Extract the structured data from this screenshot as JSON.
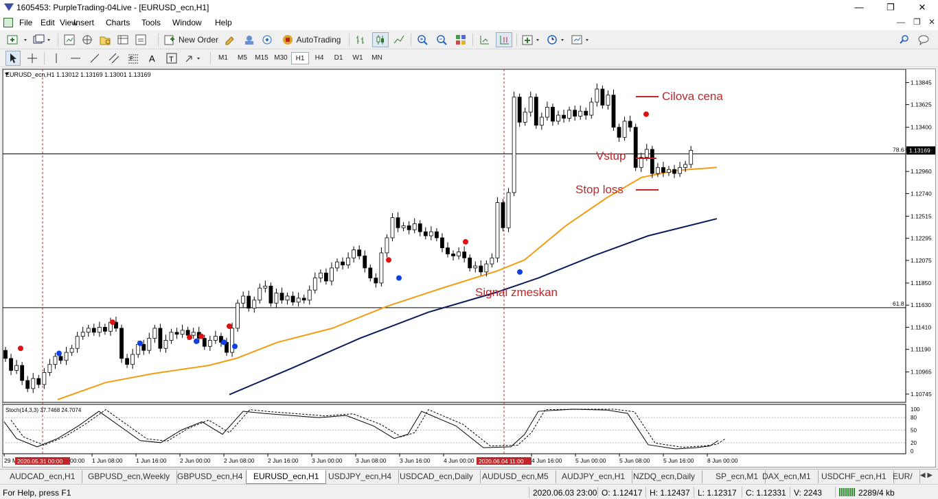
{
  "window": {
    "title": "1605453: PurpleTrading-04Live - [EURUSD_ecn,H1]"
  },
  "menu": [
    "File",
    "Edit",
    "View",
    "Insert",
    "Charts",
    "Tools",
    "Window",
    "Help"
  ],
  "toolbar": {
    "new_order": "New Order",
    "auto_trading": "AutoTrading"
  },
  "timeframes": [
    "M1",
    "M5",
    "M15",
    "M30",
    "H1",
    "H4",
    "D1",
    "W1",
    "MN"
  ],
  "active_timeframe": "H1",
  "chart": {
    "header": "EURUSD_ecn,H1  1.13012 1.13169 1.13001 1.13169",
    "current_price": "1.13169",
    "price_ticks": [
      "1.13845",
      "1.13625",
      "1.13400",
      "1.13180",
      "1.12960",
      "1.12740",
      "1.12515",
      "1.12295",
      "1.12075",
      "1.11850",
      "1.11630",
      "1.11410",
      "1.11190",
      "1.10965",
      "1.10745"
    ],
    "fib_levels": [
      {
        "label": "78.6",
        "price": 1.13135
      },
      {
        "label": "61.8",
        "price": 1.11605
      }
    ],
    "time_ticks": [
      "29 M",
      "1 Jun 08:00",
      "1 Jun 16:00",
      "2 Jun 00:00",
      "2 Jun 08:00",
      "2 Jun 16:00",
      "3 Jun 00:00",
      "3 Jun 08:00",
      "3 Jun 16:00",
      "4 Jun 00:00",
      "4 Jun 16:00",
      "5 Jun 00:00",
      "5 Jun 08:00",
      "5 Jun 16:00",
      "8 Jun 00:00"
    ],
    "time_ticks_tail": [
      "00:00"
    ],
    "vline_labels": [
      "2020.05.31 00:00",
      "2020.06.04 11:00"
    ],
    "annotations": {
      "target": "Cilova cena",
      "entry": "Vstup",
      "stop": "Stop loss",
      "missed": "Signal zmeskan"
    },
    "indicator": {
      "header": "Stoch(14,3,3) 37.7468 24.7074",
      "levels": [
        "100",
        "80",
        "50",
        "20",
        "0"
      ]
    },
    "colors": {
      "bull": "#000000",
      "bear": "#000000",
      "ma_fast": "#f39c12",
      "ma_slow": "#0b1a5c",
      "annotation": "#c0252a",
      "signal_red": "#e01010",
      "signal_blue": "#1040e0",
      "vline": "#c0252a"
    }
  },
  "tabs": [
    "AUDCAD_ecn,H1",
    "GBPUSD_ecn,Weekly",
    "GBPUSD_ecn,H4",
    "EURUSD_ecn,H1",
    "USDJPY_ecn,H4",
    "USDCAD_ecn,Daily",
    "AUDUSD_ecn,M5",
    "AUDJPY_ecn,H1",
    "NZDQ_ecn,Daily",
    "SP_ecn,M1",
    "DAX_ecn,M1",
    "USDCHF_ecn,H1",
    "EUR/"
  ],
  "active_tab": "EURUSD_ecn,H1",
  "status": {
    "help": "For Help, press F1",
    "datetime": "2020.06.03 23:00",
    "open": "O: 1.12417",
    "high": "H: 1.12437",
    "low": "L: 1.12317",
    "close": "C: 1.12331",
    "volume": "V: 2243",
    "traffic": "2289/4 kb"
  }
}
